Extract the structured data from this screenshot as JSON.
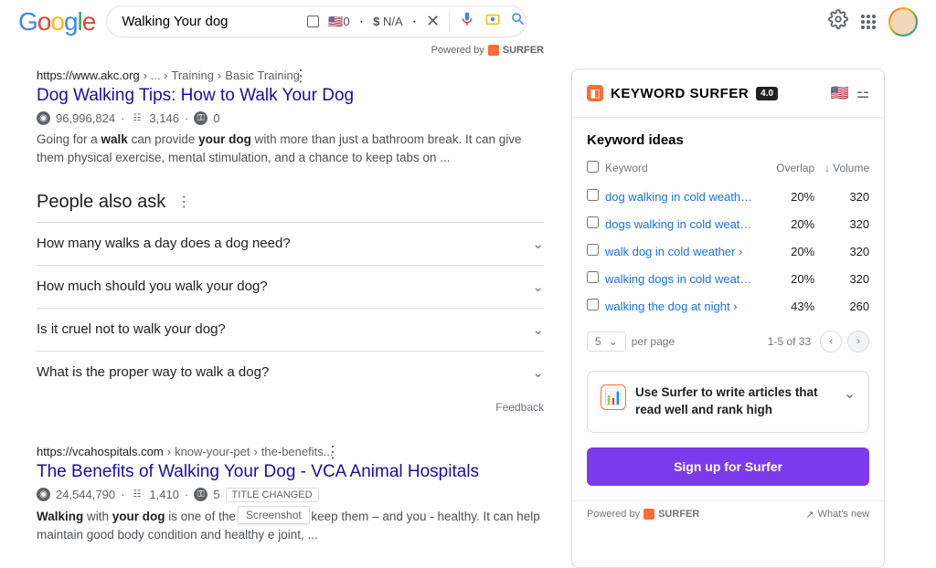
{
  "search": {
    "query": "Walking Your dog",
    "stat0": "0",
    "stat_na": "N/A",
    "powered_by": "Powered by",
    "surfer": "SURFER"
  },
  "results": [
    {
      "domain": "https://www.akc.org",
      "path_sep": "› ...  ›",
      "crumb1": "Training",
      "crumb2": "Basic Training",
      "title": "Dog Walking Tips: How to Walk Your Dog",
      "stat_pop": "96,996,824",
      "stat_words": "3,146",
      "stat_key": "0",
      "snippet_pre": "Going for a ",
      "snippet_b1": "walk",
      "snippet_mid1": " can provide ",
      "snippet_b2": "your dog",
      "snippet_post": " with more than just a bathroom break. It can give them physical exercise, mental stimulation, and a chance to keep tabs on ..."
    },
    {
      "domain": "https://vcahospitals.com",
      "path_sep": "›",
      "crumb1": "know-your-pet",
      "crumb2": "the-benefits...",
      "title": "The Benefits of Walking Your Dog - VCA Animal Hospitals",
      "stat_pop": "24,544,790",
      "stat_words": "1,410",
      "stat_key": "5",
      "title_changed": "TITLE CHANGED",
      "snippet_b1": "Walking",
      "snippet_mid1": " with ",
      "snippet_b2": "your dog",
      "snippet_post": " is one of the best ways to keep them – and you - healthy. It can help maintain good body condition and healthy                       e joint, ..."
    }
  ],
  "paa": {
    "title": "People also ask",
    "questions": [
      "How many walks a day does a dog need?",
      "How much should you walk your dog?",
      "Is it cruel not to walk your dog?",
      "What is the proper way to walk a dog?"
    ],
    "feedback": "Feedback"
  },
  "surfer": {
    "title": "KEYWORD SURFER",
    "version": "4.0",
    "ideas_title": "Keyword ideas",
    "headers": {
      "keyword": "Keyword",
      "overlap": "Overlap",
      "volume": "Volume"
    },
    "rows": [
      {
        "kw": "dog walking in cold weath…",
        "overlap": "20%",
        "volume": "320"
      },
      {
        "kw": "dogs walking in cold weat…",
        "overlap": "20%",
        "volume": "320"
      },
      {
        "kw": "walk dog in cold weather ›",
        "overlap": "20%",
        "volume": "320"
      },
      {
        "kw": "walking dogs in cold weat…",
        "overlap": "20%",
        "volume": "320"
      },
      {
        "kw": "walking the dog at night ›",
        "overlap": "43%",
        "volume": "260"
      }
    ],
    "per_page_num": "5",
    "per_page_label": "per page",
    "range": "1-5 of 33",
    "promo": "Use Surfer to write articles that read well and rank high",
    "signup": "Sign up for Surfer",
    "footer_powered": "Powered by",
    "footer_brand": "SURFER",
    "footer_whats_new": "What's new"
  },
  "tooltip": "Screenshot"
}
